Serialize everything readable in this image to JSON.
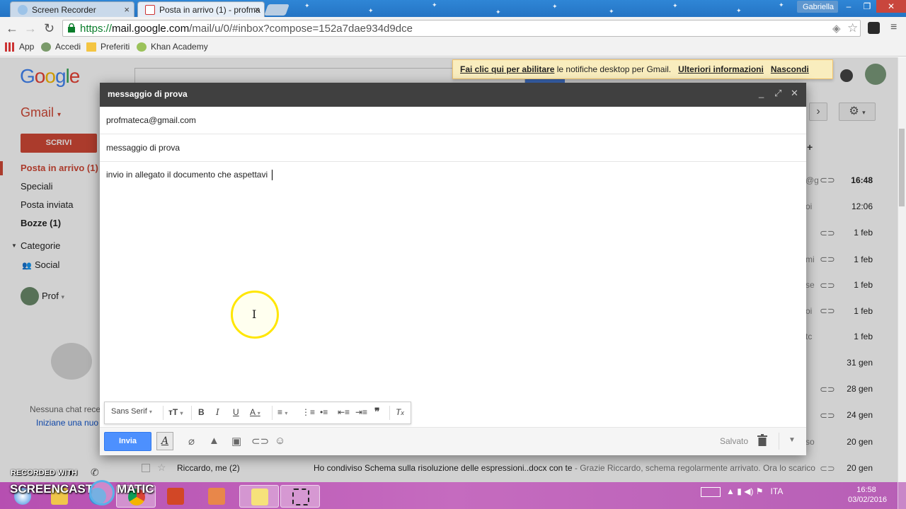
{
  "browser": {
    "tabs": [
      {
        "label": "Screen Recorder"
      },
      {
        "label": "Posta in arrivo (1) - profma"
      }
    ],
    "user": "Gabriella",
    "window_controls": {
      "minimize": "–",
      "maximize": "❐",
      "close": "✕"
    },
    "url_secure": "https://",
    "url_domain": "mail.google.com",
    "url_path": "/mail/u/0/#inbox?compose=152a7dae934d9dce",
    "bookmarks": [
      "App",
      "Accedi",
      "Preferiti",
      "Khan Academy"
    ]
  },
  "gmail": {
    "logo": "Google",
    "label": "Gmail",
    "compose_button": "SCRIVI",
    "nav": {
      "inbox": "Posta in arrivo (1)",
      "starred": "Speciali",
      "sent": "Posta inviata",
      "drafts": "Bozze (1)",
      "categories": "Categorie",
      "social": "Social"
    },
    "profile_name": "Prof",
    "chat_empty": "Nessuna chat rece",
    "chat_start": "Iniziane una nuo",
    "inbox_times": [
      "16:48",
      "12:06",
      "1 feb",
      "1 feb",
      "1 feb",
      "1 feb",
      "1 feb",
      "31 gen",
      "28 gen",
      "24 gen",
      "20 gen"
    ],
    "inbox_snippets": [
      "@g",
      "oi",
      "mi",
      "se",
      "oi",
      "tc",
      "so"
    ],
    "last_row": {
      "from": "Riccardo, me (2)",
      "subject": "Ho condiviso Schema sulla risoluzione delle espressioni..docx con te",
      "snippet": " - Grazie Riccardo, schema regolarmente arrivato. Ora lo scarico",
      "time": "20 gen"
    }
  },
  "notification": {
    "link1": "Fai clic qui per abilitare",
    "text": " le notifiche desktop per Gmail.",
    "link2": "Ulteriori informazioni",
    "link3": "Nascondi"
  },
  "compose": {
    "title": "messaggio di prova",
    "to": "profmateca@gmail.com",
    "subject": "messaggio di prova",
    "body": "invio in allegato il documento che aspettavi",
    "font": "Sans Serif",
    "send": "Invia",
    "status": "Salvato"
  },
  "watermark": {
    "line1": "RECORDED WITH",
    "line2a": "SCREENCAST",
    "line2b": "MATIC"
  },
  "taskbar": {
    "language": "ITA",
    "time": "16:58",
    "date": "03/02/2016"
  }
}
